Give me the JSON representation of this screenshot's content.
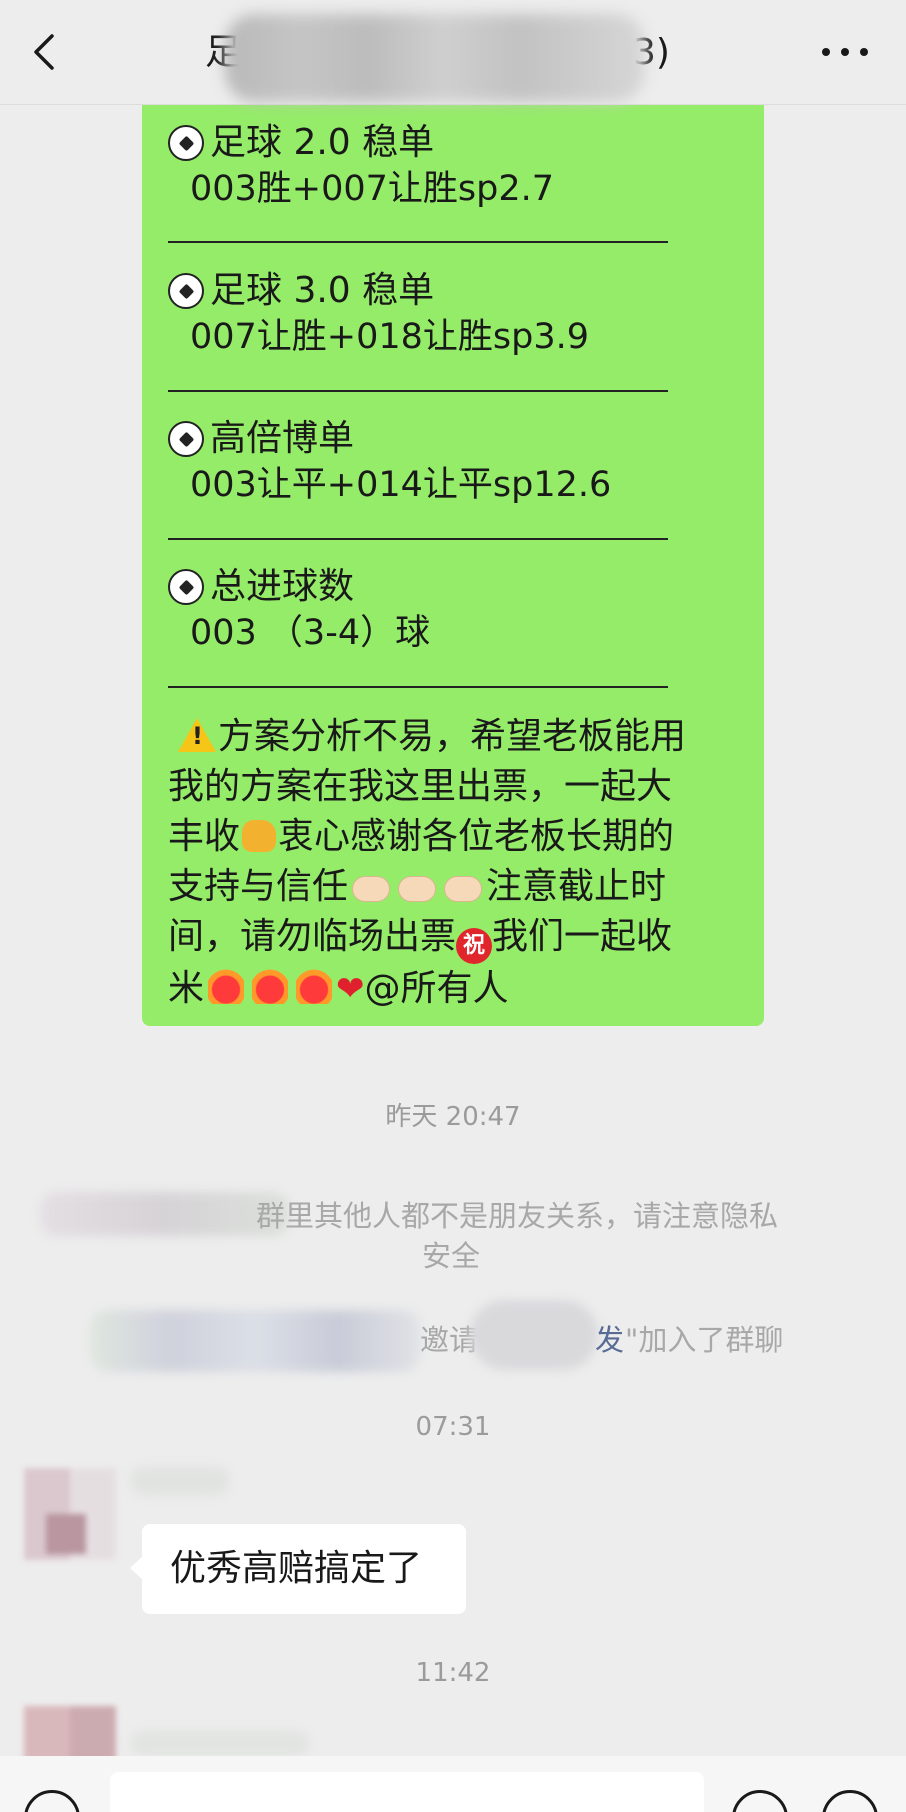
{
  "header": {
    "title_visible_start": "足",
    "title_visible_end": "3)",
    "back_icon": "chevron-left-icon",
    "more_icon": "more-dots-icon"
  },
  "message_green": {
    "sections": [
      {
        "icon": "soccer-ball",
        "title": "足球 2.0 稳单",
        "body": "003胜+007让胜sp2.7"
      },
      {
        "icon": "soccer-ball",
        "title": "足球 3.0 稳单",
        "body": "007让胜+018让胜sp3.9"
      },
      {
        "icon": "soccer-ball",
        "title": "高倍博单",
        "body": "003让平+014让平sp12.6"
      },
      {
        "icon": "soccer-ball",
        "title": "总进球数",
        "body": "003 （3-4）球"
      }
    ],
    "notice": {
      "line1": "方案分析不易，希望老板能用",
      "line2": "我的方案在我这里出票，一起大",
      "line3a": "丰收",
      "line3b": "衷心感谢各位老板长期的",
      "line4a": "支持与信任",
      "line4b": "注意截止时",
      "line5a": "间，请勿临场出票",
      "line5b": "我们一起收",
      "line6a": "米",
      "line6b": "@所有人",
      "zhu_char": "祝",
      "heart_char": "❤"
    }
  },
  "timestamps": {
    "t1": "昨天 20:47",
    "t2": "07:31",
    "t3": "11:42"
  },
  "system": {
    "privacy_line1": "群里其他人都不是朋友关系，请注意隐私",
    "privacy_line2": "安全",
    "invite_prefix": "邀请",
    "invite_name_end": "发",
    "invite_suffix": "\"加入了群聊"
  },
  "message_white": {
    "text": "优秀高赔搞定了"
  },
  "colors": {
    "bubble_green": "#95ec69",
    "background": "#ededed",
    "link_blue": "#576b95"
  }
}
